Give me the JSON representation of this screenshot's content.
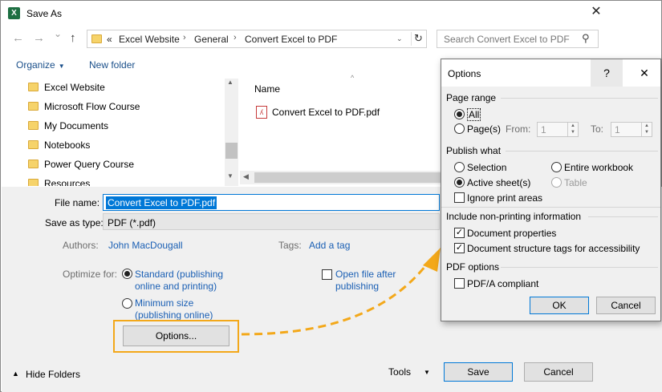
{
  "window": {
    "title": "Save As",
    "app_icon_letter": "X",
    "close": "✕"
  },
  "nav": {
    "back": "←",
    "forward": "→",
    "recent": "⌄",
    "up": "↑",
    "breadcrumb_overflow": "«",
    "breadcrumbs": [
      "Excel Website",
      "General",
      "Convert Excel to PDF"
    ],
    "refresh": "↻",
    "search_placeholder": "Search Convert Excel to PDF"
  },
  "toolbar": {
    "organize": "Organize",
    "new_folder": "New folder"
  },
  "tree": {
    "items": [
      "Excel Website",
      "Microsoft Flow Course",
      "My Documents",
      "Notebooks",
      "Power Query Course",
      "Resources"
    ]
  },
  "file_list": {
    "column_name": "Name",
    "files": [
      {
        "name": "Convert Excel to PDF.pdf"
      }
    ]
  },
  "form": {
    "file_name_label": "File name:",
    "file_name_value": "Convert Excel to PDF.pdf",
    "save_as_type_label": "Save as type:",
    "save_as_type_value": "PDF (*.pdf)",
    "authors_label": "Authors:",
    "authors_value": "John MacDougall",
    "tags_label": "Tags:",
    "tags_value": "Add a tag",
    "optimize_label": "Optimize for:",
    "optimize_standard_1": "Standard (publishing",
    "optimize_standard_2": "online and printing)",
    "optimize_min_1": "Minimum size",
    "optimize_min_2": "(publishing online)",
    "open_after_1": "Open file after",
    "open_after_2": "publishing",
    "options_button": "Options..."
  },
  "footer": {
    "hide_folders": "Hide Folders",
    "tools": "Tools",
    "save": "Save",
    "cancel": "Cancel"
  },
  "options_dialog": {
    "title": "Options",
    "help": "?",
    "close": "✕",
    "page_range": "Page range",
    "all": "All",
    "pages": "Page(s)",
    "from": "From:",
    "from_value": "1",
    "to": "To:",
    "to_value": "1",
    "publish_what": "Publish what",
    "selection": "Selection",
    "entire_workbook": "Entire workbook",
    "active_sheets": "Active sheet(s)",
    "table": "Table",
    "ignore_print_areas": "Ignore print areas",
    "non_printing": "Include non-printing information",
    "doc_properties": "Document properties",
    "doc_structure_tags": "Document structure tags for accessibility",
    "pdf_options": "PDF options",
    "pdfa": "PDF/A compliant",
    "ok": "OK",
    "cancel": "Cancel"
  },
  "colors": {
    "highlight": "#f3a81a",
    "link": "#1a5fb4",
    "selection": "#0078d7"
  }
}
